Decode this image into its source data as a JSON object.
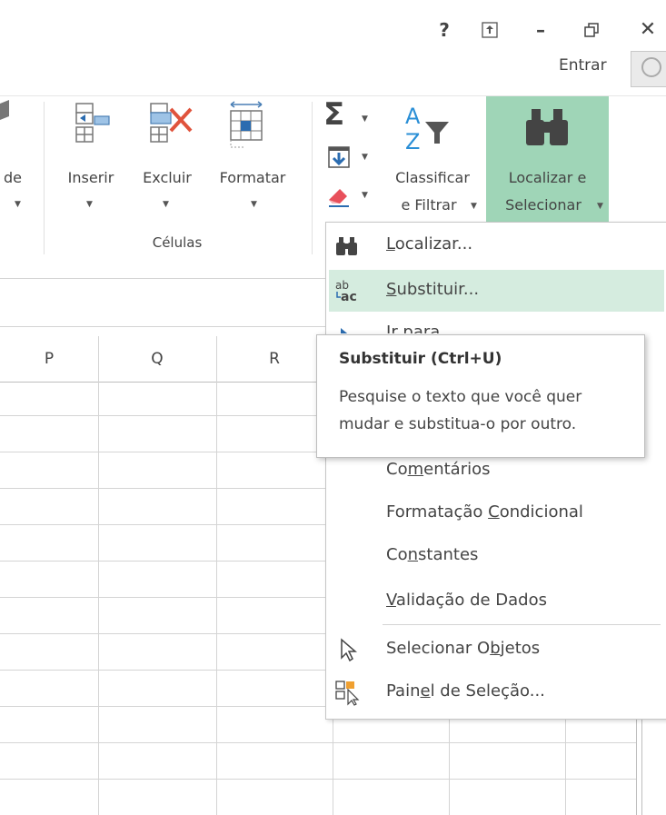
{
  "window": {
    "help": "?",
    "ribbon_display": "⇱",
    "minimize": "–",
    "restore": "🗗",
    "close": "✕",
    "sign_in": "Entrar"
  },
  "ribbon": {
    "partial_label": "de",
    "cells_group": {
      "label": "Células",
      "insert": "Inserir",
      "delete": "Excluir",
      "format": "Formatar"
    },
    "editing": {
      "sum_icon": "Σ",
      "sort_filter_line1": "Classificar",
      "sort_filter_line2": "e Filtrar",
      "find_select_line1": "Localizar e",
      "find_select_line2": "Selecionar"
    }
  },
  "grid": {
    "columns": [
      "P",
      "Q",
      "R"
    ]
  },
  "menu": {
    "items": [
      {
        "pre": "",
        "u": "L",
        "post": "ocalizar..."
      },
      {
        "pre": "",
        "u": "S",
        "post": "ubstituir..."
      },
      {
        "pre": "",
        "u": "I",
        "post": "r para..."
      },
      {
        "pre": "Co",
        "u": "m",
        "post": "entários"
      },
      {
        "pre": "Formatação ",
        "u": "C",
        "post": "ondicional"
      },
      {
        "pre": "Co",
        "u": "n",
        "post": "stantes"
      },
      {
        "pre": "",
        "u": "V",
        "post": "alidação de Dados"
      },
      {
        "pre": "Selecionar O",
        "u": "b",
        "post": "jetos"
      },
      {
        "pre": "Pain",
        "u": "e",
        "post": "l de Seleção..."
      }
    ]
  },
  "tooltip": {
    "title": "Substituir (Ctrl+U)",
    "line1": "Pesquise o texto que você quer",
    "line2": "mudar e substitua-o por outro."
  },
  "colors": {
    "accent_green": "#9fd5b7",
    "hover_green": "#d5ecdf",
    "excel_green": "#217346"
  }
}
